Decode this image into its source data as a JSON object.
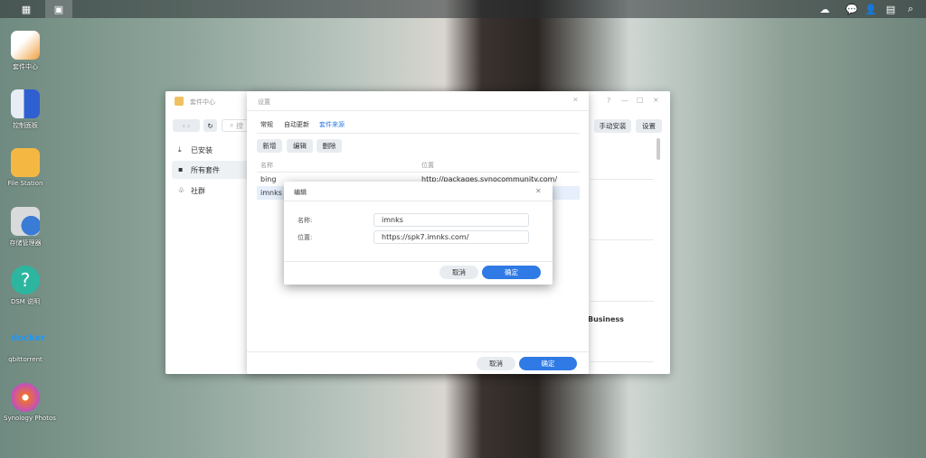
{
  "taskbar": {
    "icons": [
      "main-menu-icon",
      "package-center-icon"
    ],
    "tray_icons": [
      "cloud-sync-icon",
      "notification-icon",
      "user-icon",
      "widgets-icon",
      "search-icon"
    ]
  },
  "desktop": {
    "icons": [
      {
        "label": "套件中心",
        "icon": "package-center-icon",
        "color": "#f0a040"
      },
      {
        "label": "控制面板",
        "icon": "control-panel-icon",
        "color": "#2f5fd0"
      },
      {
        "label": "File Station",
        "icon": "folder-icon",
        "color": "#f4b842"
      },
      {
        "label": "存储管理器",
        "icon": "storage-manager-icon",
        "color": "#3a7bd5"
      },
      {
        "label": "DSM 说明",
        "icon": "help-icon",
        "color": "#2cb6a0"
      },
      {
        "label": "qbittorrent",
        "icon": "docker-icon",
        "color": "#2496ed"
      },
      {
        "label": "Synology Photos",
        "icon": "photos-icon",
        "color": "#f07030"
      }
    ]
  },
  "package_center": {
    "title": "套件中心",
    "controls": [
      "?",
      "—",
      "□",
      "×"
    ],
    "search_placeholder": "搜",
    "sidebar": [
      {
        "label": "已安装",
        "icon": "download-icon"
      },
      {
        "label": "所有套件",
        "icon": "grid-icon",
        "selected": true
      },
      {
        "label": "社群",
        "icon": "community-icon"
      }
    ],
    "manual_install": "手动安装",
    "settings": "设置",
    "content_partial_text": "Business"
  },
  "settings_dialog": {
    "title": "设置",
    "tabs": [
      {
        "label": "常规"
      },
      {
        "label": "自动更新"
      },
      {
        "label": "套件来源",
        "active": true
      }
    ],
    "toolbar": {
      "add": "新增",
      "edit": "编辑",
      "delete": "删除"
    },
    "table": {
      "headers": [
        "名称",
        "位置"
      ],
      "rows": [
        {
          "name": "bing",
          "location": "http://packages.synocommunity.com/"
        },
        {
          "name": "imnks",
          "location": "",
          "selected": true
        }
      ]
    },
    "cancel": "取消",
    "ok": "确定"
  },
  "edit_dialog": {
    "title": "编辑",
    "name_label": "名称:",
    "name_value": "imnks",
    "location_label": "位置:",
    "location_value": "https://spk7.imnks.com/",
    "cancel": "取消",
    "ok": "确定"
  },
  "colors": {
    "accent": "#2f7ae5",
    "selected_row": "#e6effb"
  }
}
